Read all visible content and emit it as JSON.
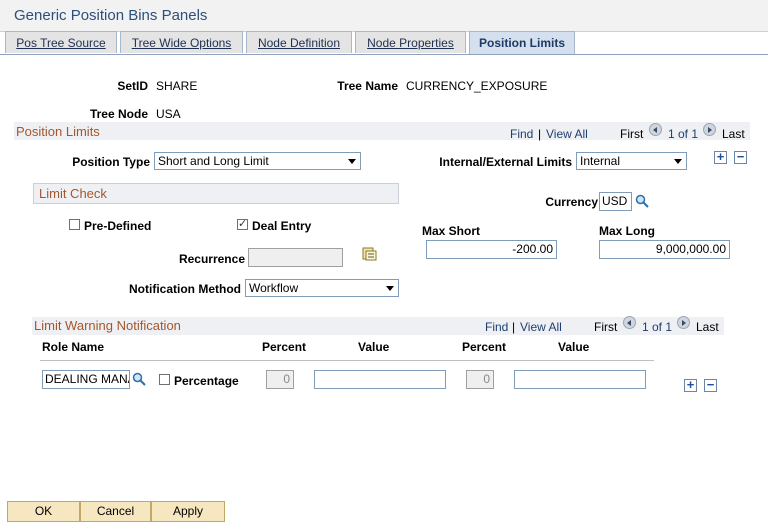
{
  "title": "Generic Position Bins Panels",
  "tabs": [
    {
      "label": "Pos Tree Source"
    },
    {
      "label": "Tree Wide Options"
    },
    {
      "label": "Node Definition"
    },
    {
      "label": "Node Properties"
    },
    {
      "label": "Position Limits"
    }
  ],
  "header": {
    "setid_label": "SetID",
    "setid_value": "SHARE",
    "tree_name_label": "Tree Name",
    "tree_name_value": "CURRENCY_EXPOSURE",
    "tree_node_label": "Tree Node",
    "tree_node_value": "USA"
  },
  "position_limits": {
    "title": "Position Limits",
    "find": "Find",
    "sep": "|",
    "view_all": "View All",
    "first": "First",
    "count": "1 of 1",
    "last": "Last",
    "position_type_label": "Position Type",
    "position_type_value": "Short and Long Limit",
    "int_ext_label": "Internal/External Limits",
    "int_ext_value": "Internal",
    "currency_label": "Currency",
    "currency_value": "USD",
    "max_short_label": "Max Short",
    "max_short_value": "-200.00",
    "max_long_label": "Max Long",
    "max_long_value": "9,000,000.00"
  },
  "limit_check": {
    "title": "Limit Check",
    "predefined_label": "Pre-Defined",
    "predefined_checked": false,
    "deal_entry_label": "Deal Entry",
    "deal_entry_checked": true,
    "recurrence_label": "Recurrence",
    "notification_label": "Notification Method",
    "notification_value": "Workflow"
  },
  "warning": {
    "title": "Limit Warning Notification",
    "find": "Find",
    "sep": "|",
    "view_all": "View All",
    "first": "First",
    "count": "1 of 1",
    "last": "Last",
    "col_role": "Role Name",
    "col_percent1": "Percent",
    "col_value1": "Value",
    "col_percent2": "Percent",
    "col_value2": "Value",
    "role_value": "DEALING MANA",
    "percentage_label": "Percentage",
    "percent1_value": "0",
    "percent2_value": "0"
  },
  "buttons": {
    "ok": "OK",
    "cancel": "Cancel",
    "apply": "Apply"
  },
  "colors": {
    "section": "#a5572c",
    "title": "#2c4f7c",
    "button": "#f7e7c0"
  }
}
